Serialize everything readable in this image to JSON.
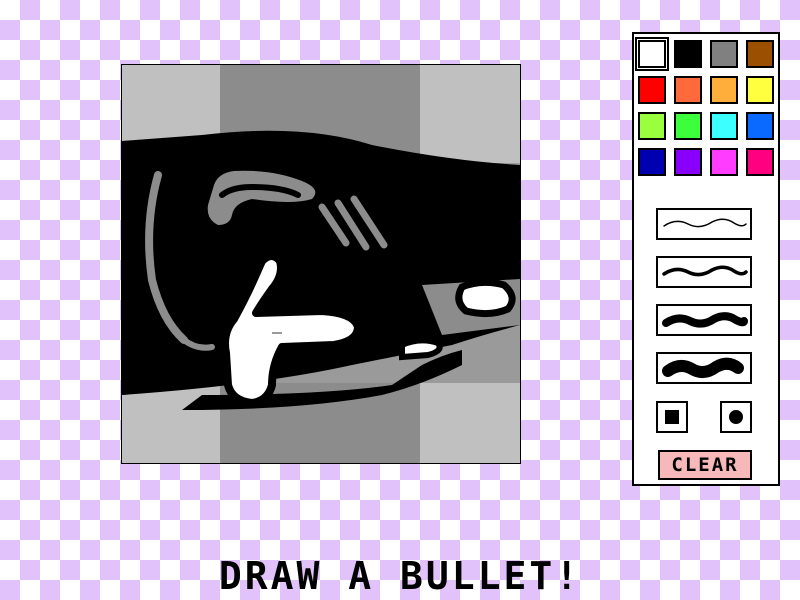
{
  "prompt": {
    "text": "DRAW A BULLET!"
  },
  "canvas": {
    "background_color": "#9a9a9a",
    "background_light_color": "#c0c0c0",
    "background_dark_color": "#8c8c8c"
  },
  "palette": {
    "colors": [
      {
        "name": "white",
        "hex": "#ffffff"
      },
      {
        "name": "black",
        "hex": "#000000"
      },
      {
        "name": "gray",
        "hex": "#808080"
      },
      {
        "name": "brown",
        "hex": "#9a5000"
      },
      {
        "name": "red",
        "hex": "#ff0000"
      },
      {
        "name": "orange",
        "hex": "#ff6a3d"
      },
      {
        "name": "light-orange",
        "hex": "#ffae3c"
      },
      {
        "name": "yellow",
        "hex": "#ffff40"
      },
      {
        "name": "lime",
        "hex": "#9aff3c"
      },
      {
        "name": "green",
        "hex": "#3cff3c"
      },
      {
        "name": "cyan",
        "hex": "#3cffff"
      },
      {
        "name": "blue",
        "hex": "#0a6aff"
      },
      {
        "name": "navy",
        "hex": "#0000b0"
      },
      {
        "name": "purple",
        "hex": "#8a00ff"
      },
      {
        "name": "magenta",
        "hex": "#ff3cff"
      },
      {
        "name": "pink",
        "hex": "#ff0080"
      }
    ],
    "selected": "white"
  },
  "brushes": {
    "sizes": [
      "thin",
      "medium",
      "thick",
      "extra-thick"
    ]
  },
  "shapes": {
    "options": [
      "square",
      "round"
    ]
  },
  "clear_button": {
    "label": "CLEAR"
  }
}
